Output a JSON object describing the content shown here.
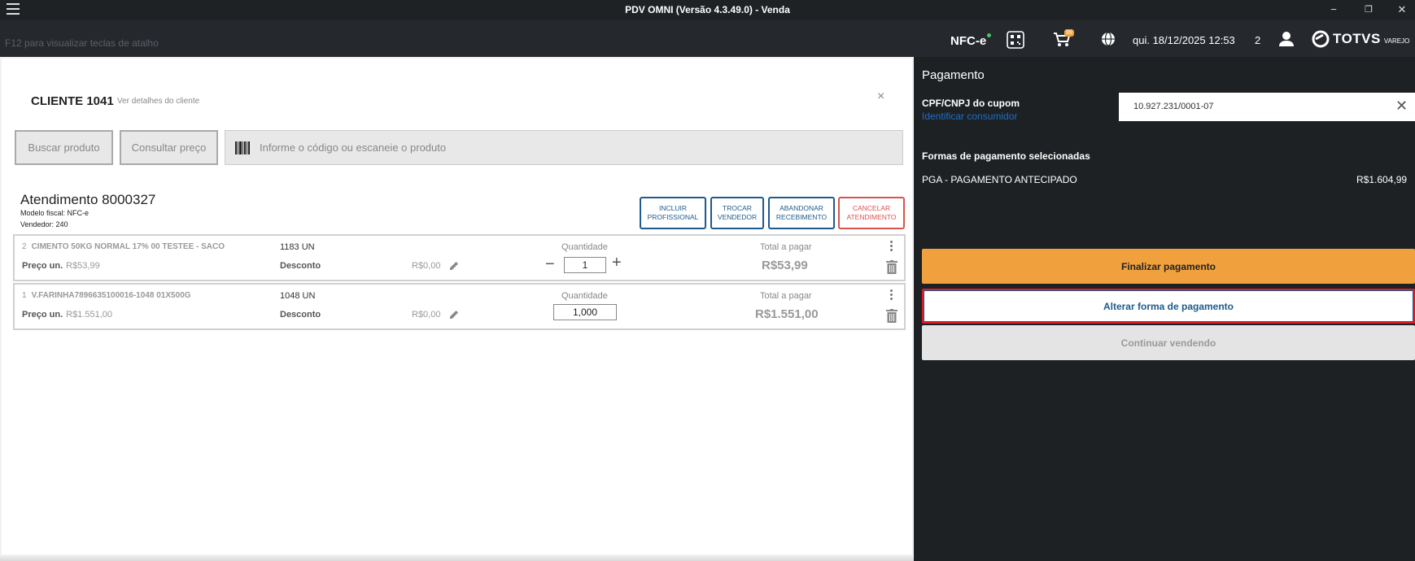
{
  "window": {
    "title": "PDV OMNI (Versão 4.3.49.0) - Venda",
    "minimize": "−",
    "restore": "❐",
    "close": "✕"
  },
  "header": {
    "shortcut_hint": "F12 para visualizar teclas de atalho",
    "nfce_label": "NFC-e",
    "cart_badge": "99",
    "datetime": "qui. 18/12/2025 12:53",
    "user_count": "2",
    "brand_name": "TOTVS",
    "brand_sub": "VAREJO"
  },
  "client": {
    "title": "CLIENTE 1041",
    "details_link": "Ver detalhes do cliente",
    "close": "×"
  },
  "search": {
    "buscar_label": "Buscar produto",
    "consultar_label": "Consultar preço",
    "placeholder": "Informe o código ou escaneie o produto"
  },
  "atendimento": {
    "title": "Atendimento 8000327",
    "modelo": "Modelo fiscal: NFC-e",
    "vendedor": "Vendedor: 240",
    "actions": [
      {
        "label": "INCLUIR PROFISSIONAL"
      },
      {
        "label": "TROCAR VENDEDOR"
      },
      {
        "label": "ABANDONAR RECEBIMENTO"
      },
      {
        "label": "CANCELAR ATENDIMENTO"
      }
    ]
  },
  "items": [
    {
      "index": "2",
      "name": "CIMENTO 50KG NORMAL 17% 00 TESTEE - SACO",
      "code": "1183  UN",
      "price_label": "Preço un.",
      "price": "R$53,99",
      "discount_label": "Desconto",
      "discount": "R$0,00",
      "qty_label": "Quantidade",
      "qty": "1",
      "total_label": "Total a pagar",
      "total": "R$53,99"
    },
    {
      "index": "1",
      "name": "V.FARINHA7896635100016-1048 01X500G",
      "code": "1048  UN",
      "price_label": "Preço un.",
      "price": "R$1.551,00",
      "discount_label": "Desconto",
      "discount": "R$0,00",
      "qty_label": "Quantidade",
      "qty": "1,000",
      "total_label": "Total a pagar",
      "total": "R$1.551,00"
    }
  ],
  "payment": {
    "title": "Pagamento",
    "cpf_label": "CPF/CNPJ do cupom",
    "identify_link": "Identificar consumidor",
    "cpf_value": "10.927.231/0001-07",
    "clear": "✕",
    "forms_label": "Formas de pagamento selecionadas",
    "forms": [
      {
        "name": "PGA - PAGAMENTO ANTECIPADO",
        "value": "R$1.604,99"
      }
    ],
    "finalize_label": "Finalizar pagamento",
    "alter_label": "Alterar forma de pagamento",
    "continue_label": "Continuar vendendo"
  },
  "colors": {
    "accent_orange": "#f0a03d",
    "primary_blue": "#1d5a8e",
    "cancel_red": "#d9534f",
    "highlight_red": "#e01b24"
  }
}
